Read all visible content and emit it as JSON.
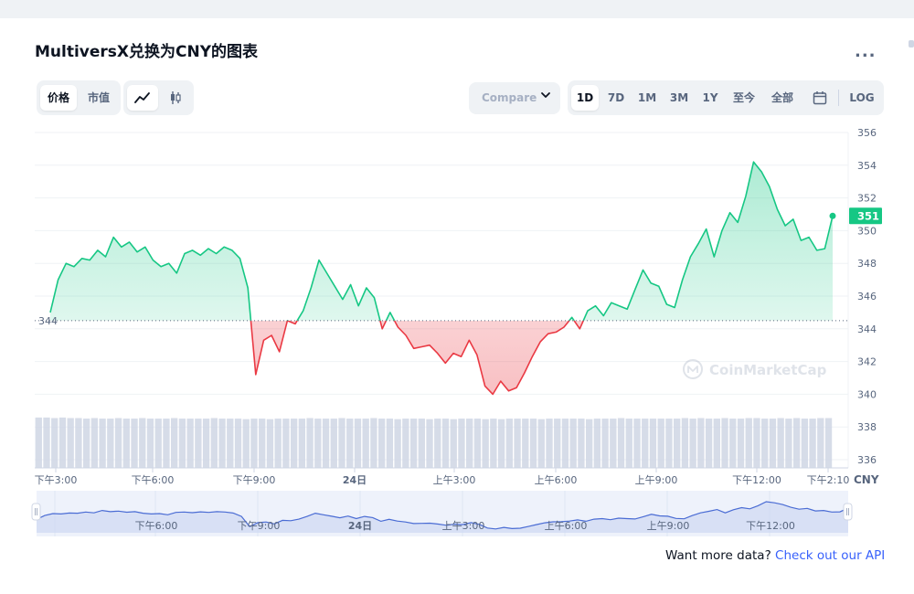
{
  "header": {
    "title": "MultiversX兑换为CNY的图表",
    "more_label": "..."
  },
  "toolbar": {
    "metric_tabs": [
      {
        "label": "价格",
        "active": true
      },
      {
        "label": "市值",
        "active": false
      }
    ],
    "chart_type_icons": [
      {
        "icon": "line-chart-icon",
        "active": true
      },
      {
        "icon": "candlestick-icon",
        "active": false
      }
    ],
    "compare_label": "Compare",
    "compare_icon": "chevron-down-icon",
    "range_tabs": [
      {
        "label": "1D",
        "active": true
      },
      {
        "label": "7D",
        "active": false
      },
      {
        "label": "1M",
        "active": false
      },
      {
        "label": "3M",
        "active": false
      },
      {
        "label": "1Y",
        "active": false
      },
      {
        "label": "至今",
        "active": false
      },
      {
        "label": "全部",
        "active": false
      }
    ],
    "calendar_icon": "calendar-icon",
    "log_label": "LOG"
  },
  "chart_data": {
    "type": "area",
    "currency_label": "CNY",
    "baseline": 344.5,
    "baseline_label": "344",
    "current_price_label": "351",
    "watermark": "CoinMarketCap",
    "ylim": [
      336,
      356
    ],
    "y_ticks": [
      336,
      338,
      340,
      342,
      344,
      346,
      348,
      350,
      352,
      354,
      356
    ],
    "x_ticks": [
      "下午3:00",
      "下午6:00",
      "下午9:00",
      "24日",
      "上午3:00",
      "上午6:00",
      "上午9:00",
      "下午12:00",
      "下午2:10"
    ],
    "colors": {
      "up": "#16c784",
      "down": "#ea3943",
      "navigator": "#4a6cd4"
    },
    "price": [
      345.0,
      347.0,
      348.0,
      347.8,
      348.3,
      348.2,
      348.8,
      348.4,
      349.6,
      349.0,
      349.3,
      348.7,
      349.0,
      348.2,
      347.8,
      348.0,
      347.4,
      348.6,
      348.8,
      348.5,
      348.9,
      348.6,
      349.0,
      348.8,
      348.3,
      346.5,
      341.2,
      343.3,
      343.6,
      342.6,
      344.5,
      344.3,
      345.1,
      346.5,
      348.2,
      347.4,
      346.6,
      345.8,
      346.7,
      345.4,
      346.5,
      345.9,
      344.0,
      345.0,
      344.1,
      343.6,
      342.8,
      342.9,
      343.0,
      342.5,
      341.9,
      342.5,
      342.3,
      343.3,
      342.4,
      340.5,
      340.0,
      340.8,
      340.2,
      340.4,
      341.3,
      342.3,
      343.2,
      343.7,
      343.8,
      344.1,
      344.7,
      344.0,
      345.1,
      345.4,
      344.8,
      345.6,
      345.4,
      345.2,
      346.4,
      347.6,
      346.8,
      346.6,
      345.5,
      345.3,
      347.0,
      348.4,
      349.2,
      350.1,
      348.4,
      350.0,
      351.1,
      350.5,
      352.1,
      354.2,
      353.6,
      352.7,
      351.3,
      350.3,
      350.7,
      349.4,
      349.6,
      348.8,
      348.9,
      350.9
    ],
    "volume": [
      95,
      95,
      94,
      95,
      94,
      94,
      93,
      94,
      93,
      93,
      94,
      93,
      93,
      94,
      93,
      93,
      93,
      94,
      93,
      93,
      93,
      93,
      94,
      93,
      93,
      93,
      92,
      93,
      93,
      92,
      93,
      93,
      93,
      93,
      94,
      93,
      93,
      93,
      94,
      93,
      93,
      93,
      94,
      93,
      93,
      92,
      93,
      93,
      93,
      92,
      93,
      93,
      92,
      93,
      93,
      93,
      92,
      93,
      92,
      93,
      93,
      93,
      93,
      92,
      93,
      93,
      93,
      93,
      93,
      92,
      93,
      93,
      93,
      94,
      93,
      93,
      93,
      93,
      93,
      93,
      93,
      94,
      93,
      94,
      93,
      93,
      94,
      93,
      93,
      94,
      94,
      93,
      93,
      94,
      93,
      94,
      93,
      93,
      94,
      94
    ]
  },
  "navigator": {
    "labels": [
      "下午6:00",
      "下午9:00",
      "24日",
      "上午3:00",
      "上午6:00",
      "上午9:00",
      "下午12:00"
    ]
  },
  "footer": {
    "text": "Want more data?",
    "link": "Check out our API"
  }
}
